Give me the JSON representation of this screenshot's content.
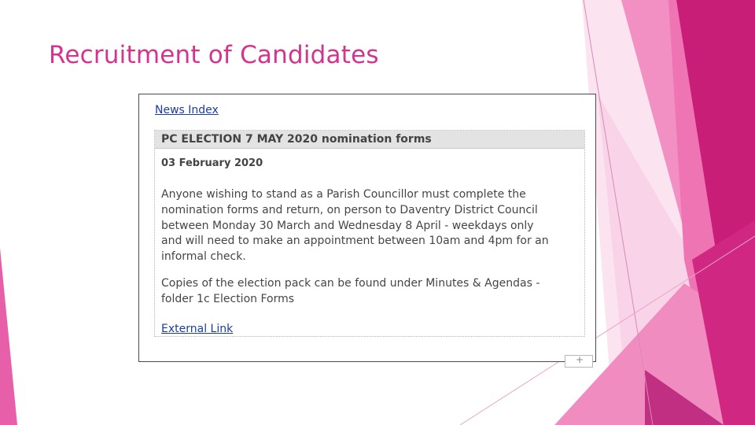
{
  "slide": {
    "title": "Recruitment of Candidates",
    "title_color": "#d6338f",
    "decor_colors": [
      "#f7c6e0",
      "#f08cc0",
      "#e0509e",
      "#c81e78",
      "#b0176a"
    ]
  },
  "screenshot": {
    "news_index_link": "News Index",
    "article": {
      "heading": "PC ELECTION 7 MAY 2020 nomination forms",
      "date": "03 February 2020",
      "paragraph1_lines": [
        "Anyone wishing to stand as a Parish Councillor must complete the",
        "nomination forms and return, on person to Daventry District Council",
        "between Monday 30 March and Wednesday 8 April - weekdays only",
        "and will need to make an appointment between 10am and 4pm for an",
        "informal check."
      ],
      "paragraph2_lines": [
        "Copies of the election pack can be found under Minutes & Agendas -",
        "folder 1c Election Forms"
      ],
      "external_link": "External Link"
    },
    "corner_widget_icon": "+"
  }
}
